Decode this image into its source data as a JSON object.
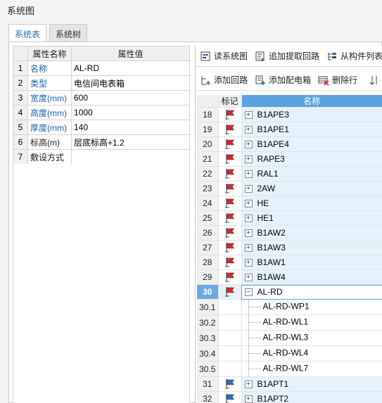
{
  "window": {
    "title": "系统图"
  },
  "tabs": [
    {
      "label": "系统表",
      "active": true
    },
    {
      "label": "系统树",
      "active": false
    }
  ],
  "properties": {
    "headers": {
      "name": "属性名称",
      "value": "属性值"
    },
    "rows": [
      {
        "idx": "1",
        "name": "名称",
        "value": "AL-RD",
        "highlight": true
      },
      {
        "idx": "2",
        "name": "类型",
        "value": "电信间电表箱",
        "highlight": true
      },
      {
        "idx": "3",
        "name": "宽度(mm)",
        "value": "600",
        "highlight": true
      },
      {
        "idx": "4",
        "name": "高度(mm)",
        "value": "1000",
        "highlight": true
      },
      {
        "idx": "5",
        "name": "厚度(mm)",
        "value": "140",
        "highlight": true
      },
      {
        "idx": "6",
        "name": "标高(m)",
        "value": "层底标高+1.2",
        "highlight": false
      },
      {
        "idx": "7",
        "name": "敷设方式",
        "value": "",
        "highlight": false
      }
    ]
  },
  "toolbar1": {
    "read_label": "读系统图",
    "append_label": "追加提取回路",
    "from_list_label": "从构件列表"
  },
  "toolbar2": {
    "add_loop_label": "添加回路",
    "add_box_label": "添加配电箱",
    "delete_row_label": "删除行"
  },
  "grid": {
    "headers": {
      "no": "",
      "mark": "标记",
      "name": "名称"
    },
    "rows": [
      {
        "no": "18",
        "name": "B1APE3",
        "type": "parent",
        "flag": "red"
      },
      {
        "no": "19",
        "name": "B1APE1",
        "type": "parent",
        "flag": "red"
      },
      {
        "no": "20",
        "name": "B1APE4",
        "type": "parent",
        "flag": "red"
      },
      {
        "no": "21",
        "name": "RAPE3",
        "type": "parent",
        "flag": "red"
      },
      {
        "no": "22",
        "name": "RAL1",
        "type": "parent",
        "flag": "red"
      },
      {
        "no": "23",
        "name": "2AW",
        "type": "parent",
        "flag": "red"
      },
      {
        "no": "24",
        "name": "HE",
        "type": "parent",
        "flag": "red"
      },
      {
        "no": "25",
        "name": "HE1",
        "type": "parent",
        "flag": "red"
      },
      {
        "no": "26",
        "name": "B1AW2",
        "type": "parent",
        "flag": "red"
      },
      {
        "no": "27",
        "name": "B1AW3",
        "type": "parent",
        "flag": "red"
      },
      {
        "no": "28",
        "name": "B1AW1",
        "type": "parent",
        "flag": "red"
      },
      {
        "no": "29",
        "name": "B1AW4",
        "type": "parent",
        "flag": "red"
      },
      {
        "no": "30",
        "name": "AL-RD",
        "type": "expanded",
        "flag": "red",
        "selected": true
      },
      {
        "no": "30.1",
        "name": "AL-RD-WP1",
        "type": "child"
      },
      {
        "no": "30.2",
        "name": "AL-RD-WL1",
        "type": "child"
      },
      {
        "no": "30.3",
        "name": "AL-RD-WL3",
        "type": "child"
      },
      {
        "no": "30.4",
        "name": "AL-RD-WL4",
        "type": "child"
      },
      {
        "no": "30.5",
        "name": "AL-RD-WL7",
        "type": "child"
      },
      {
        "no": "31",
        "name": "B1APT1",
        "type": "parent",
        "flag": "blue"
      },
      {
        "no": "32",
        "name": "B1APT2",
        "type": "parent",
        "flag": "blue"
      }
    ]
  },
  "colors": {
    "accent": "#5ba3e0",
    "flag_red": "#e0242b",
    "flag_blue": "#2b6cc4",
    "row_name_bg": "#e5f2fb"
  }
}
